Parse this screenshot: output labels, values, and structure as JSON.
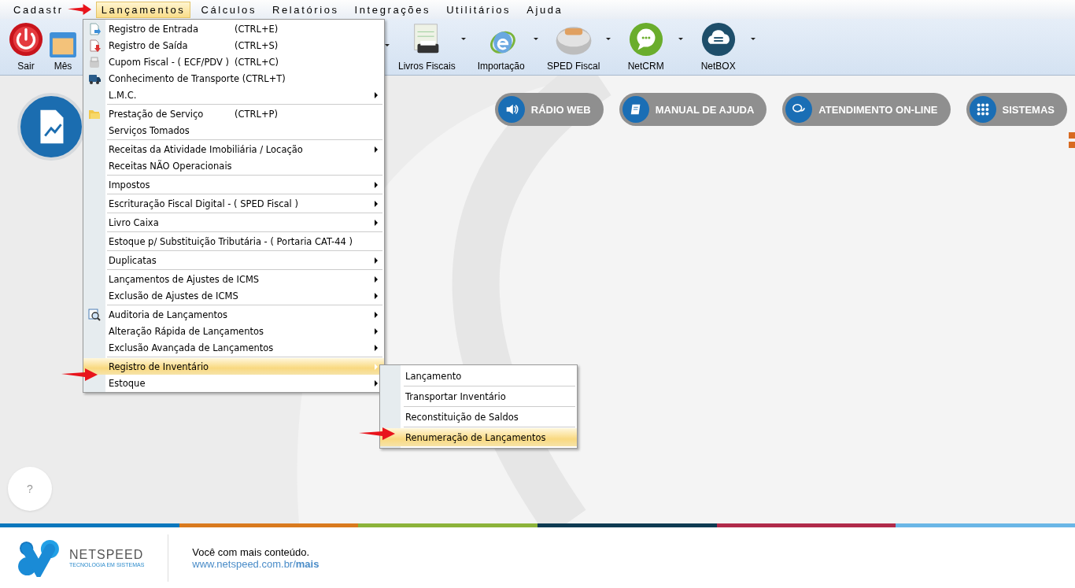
{
  "menubar": [
    {
      "label": "Cadastr",
      "selected": false
    },
    {
      "label": "Lançamentos",
      "selected": true
    },
    {
      "label": "Cálculos",
      "selected": false
    },
    {
      "label": "Relatórios",
      "selected": false
    },
    {
      "label": "Integrações",
      "selected": false
    },
    {
      "label": "Utilitários",
      "selected": false
    },
    {
      "label": "Ajuda",
      "selected": false
    }
  ],
  "toolbar": [
    {
      "label": "Sair",
      "dropdown": false
    },
    {
      "label": "Mês",
      "dropdown": false
    },
    {
      "label": "Livros Fiscais",
      "dropdown": true
    },
    {
      "label": "Importação",
      "dropdown": true
    },
    {
      "label": "SPED Fiscal",
      "dropdown": true
    },
    {
      "label": "NetCRM",
      "dropdown": true
    },
    {
      "label": "NetBOX",
      "dropdown": true
    }
  ],
  "menu": {
    "groups": [
      [
        {
          "label": "Registro de Entrada",
          "shortcut": "(CTRL+E)",
          "submenu": false,
          "selected": false
        },
        {
          "label": "Registro de Saída",
          "shortcut": "(CTRL+S)",
          "submenu": false,
          "selected": false
        },
        {
          "label": "Cupom Fiscal - ( ECF/PDV )",
          "shortcut": "(CTRL+C)",
          "submenu": false,
          "selected": false
        },
        {
          "label": "Conhecimento de Transporte (CTRL+T)",
          "submenu": false,
          "selected": false
        },
        {
          "label": "L.M.C.",
          "submenu": true,
          "selected": false
        }
      ],
      [
        {
          "label": "Prestação de Serviço",
          "shortcut": "(CTRL+P)",
          "submenu": false,
          "selected": false
        },
        {
          "label": "Serviços Tomados",
          "submenu": false,
          "selected": false
        }
      ],
      [
        {
          "label": "Receitas da Atividade Imobiliária / Locação",
          "submenu": true,
          "selected": false
        },
        {
          "label": "Receitas NÃO Operacionais",
          "submenu": false,
          "selected": false
        }
      ],
      [
        {
          "label": "Impostos",
          "submenu": true,
          "selected": false
        }
      ],
      [
        {
          "label": "Escrituração Fiscal Digital - ( SPED Fiscal )",
          "submenu": true,
          "selected": false
        }
      ],
      [
        {
          "label": "Livro Caixa",
          "submenu": true,
          "selected": false
        }
      ],
      [
        {
          "label": "Estoque p/ Substituição Tributária - ( Portaria CAT-44 )",
          "submenu": false,
          "selected": false
        }
      ],
      [
        {
          "label": "Duplicatas",
          "submenu": true,
          "selected": false
        }
      ],
      [
        {
          "label": "Lançamentos de Ajustes de ICMS",
          "submenu": true,
          "selected": false
        },
        {
          "label": "Exclusão de Ajustes de ICMS",
          "submenu": true,
          "selected": false
        }
      ],
      [
        {
          "label": "Auditoria de Lançamentos",
          "submenu": true,
          "selected": false
        },
        {
          "label": "Alteração Rápida de Lançamentos",
          "submenu": true,
          "selected": false
        },
        {
          "label": "Exclusão Avançada de Lançamentos",
          "submenu": true,
          "selected": false
        }
      ],
      [
        {
          "label": "Registro de Inventário",
          "submenu": true,
          "selected": true
        },
        {
          "label": "Estoque",
          "submenu": true,
          "selected": false
        }
      ]
    ]
  },
  "submenu": [
    {
      "label": "Lançamento",
      "selected": false
    },
    {
      "label": "Transportar Inventário",
      "selected": false
    },
    {
      "label": "Reconstituição de Saldos",
      "selected": false
    },
    {
      "label": "Renumeração de Lançamentos",
      "selected": true
    }
  ],
  "quick_buttons": [
    {
      "label": "RÁDIO WEB"
    },
    {
      "label": "MANUAL DE AJUDA"
    },
    {
      "label": "ATENDIMENTO ON-LINE"
    },
    {
      "label": "SISTEMAS"
    }
  ],
  "help_button": "?",
  "footer": {
    "brand": "NETSPEED",
    "tagline": "TECNOLOGIA EM SISTEMAS",
    "message": "Você com mais conteúdo.",
    "link": "www.netspeed.com.br/**mais**"
  }
}
